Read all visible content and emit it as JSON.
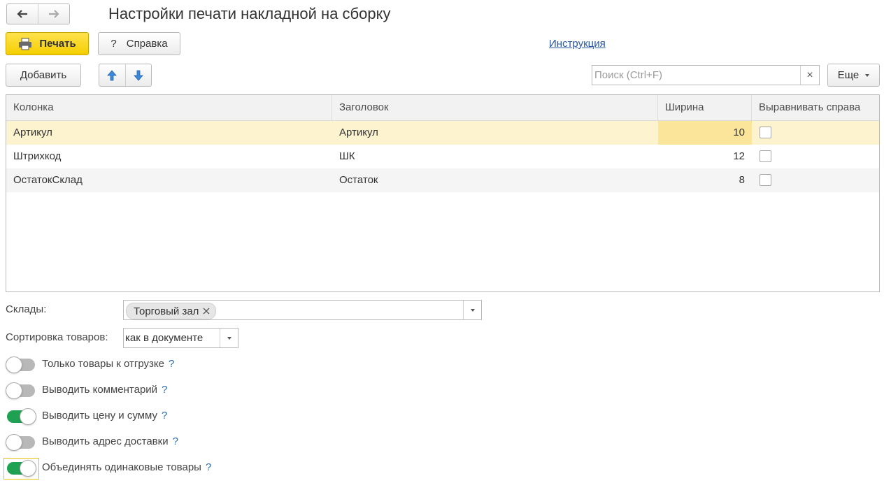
{
  "window": {
    "title": "Настройки печати накладной на сборку"
  },
  "nav": {
    "back_icon": "arrow-left",
    "forward_icon": "arrow-right"
  },
  "toolbar": {
    "print_label": "Печать",
    "help_label": "Справка",
    "help_prefix": "?",
    "instruction_link": "Инструкция"
  },
  "table_toolbar": {
    "add_label": "Добавить",
    "search_placeholder": "Поиск (Ctrl+F)",
    "search_clear": "×",
    "more_label": "Еще"
  },
  "table": {
    "columns": [
      "Колонка",
      "Заголовок",
      "Ширина",
      "Выравнивать справа"
    ],
    "rows": [
      {
        "column": "Артикул",
        "header": "Артикул",
        "width": "10",
        "align_right": false
      },
      {
        "column": "Штрихкод",
        "header": "ШК",
        "width": "12",
        "align_right": false
      },
      {
        "column": "ОстатокСклад",
        "header": "Остаток",
        "width": "8",
        "align_right": false
      }
    ]
  },
  "form": {
    "warehouses_label": "Склады:",
    "warehouse_chip": "Торговый зал",
    "sort_label": "Сортировка товаров:",
    "sort_value": "как в документе"
  },
  "toggles": [
    {
      "label": "Только товары к отгрузке",
      "on": false
    },
    {
      "label": "Выводить комментарий",
      "on": false
    },
    {
      "label": "Выводить цену и сумму",
      "on": true
    },
    {
      "label": "Выводить адрес доставки",
      "on": false
    },
    {
      "label": "Объединять одинаковые товары",
      "on": true
    }
  ],
  "help_mark": "?",
  "colors": {
    "accent_yellow": "#f5cf00",
    "toggle_on": "#1fa152",
    "selected_row": "#fdf3cf",
    "selected_cell": "#fbe59a",
    "link": "#2857a4"
  }
}
